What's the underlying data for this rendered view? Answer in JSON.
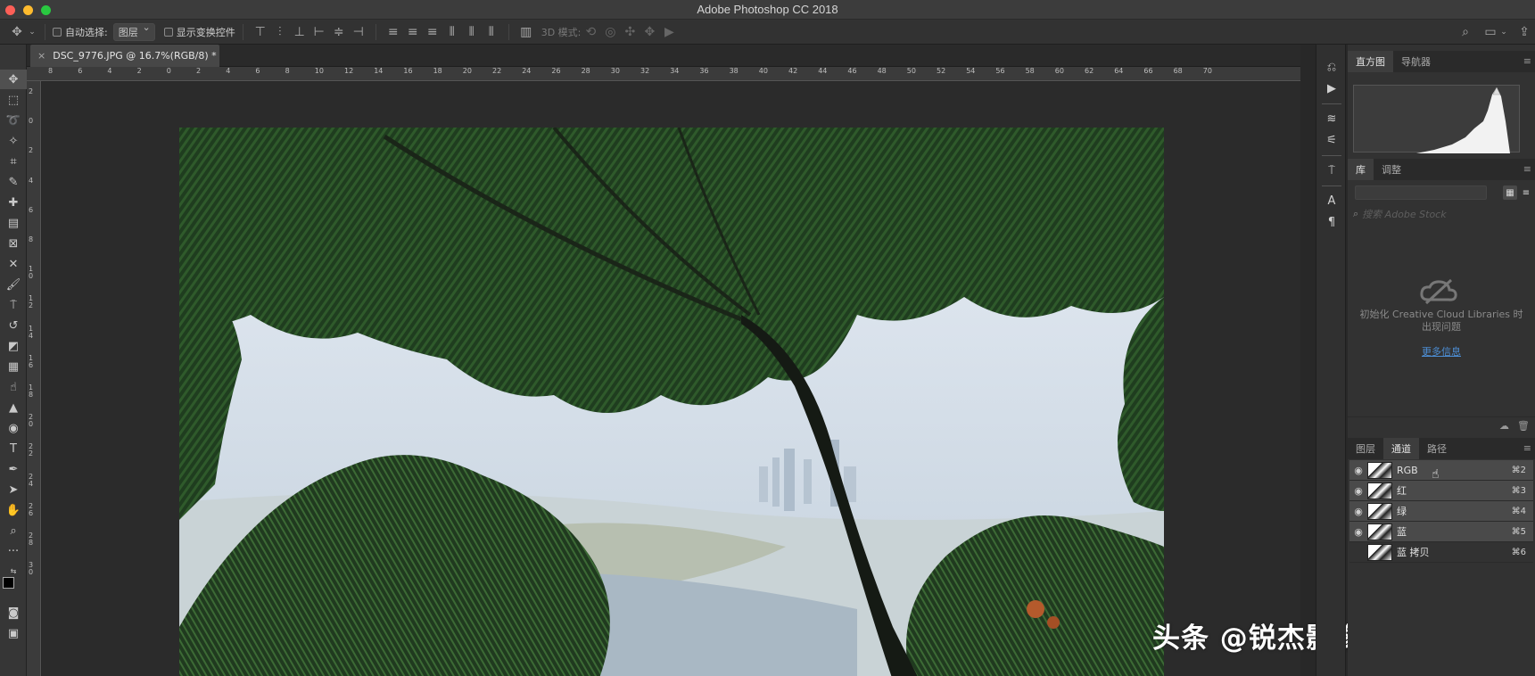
{
  "app": {
    "title": "Adobe Photoshop CC 2018"
  },
  "options_bar": {
    "auto_select_label": "自动选择:",
    "auto_select_value": "图层",
    "show_transform_label": "显示变换控件",
    "mode_3d_label": "3D 模式:"
  },
  "document": {
    "tab_title": "DSC_9776.JPG @ 16.7%(RGB/8) *",
    "tab_close": "×"
  },
  "ruler": {
    "h_labels": [
      "8",
      "6",
      "4",
      "2",
      "0",
      "2",
      "4",
      "6",
      "8",
      "10",
      "12",
      "14",
      "16",
      "18",
      "20",
      "22",
      "24",
      "26",
      "28",
      "30",
      "32",
      "34",
      "36",
      "38",
      "40",
      "42",
      "44",
      "46",
      "48",
      "50",
      "52",
      "54",
      "56",
      "58",
      "60",
      "62",
      "64",
      "66",
      "68",
      "70"
    ],
    "v_labels": [
      "2",
      "0",
      "2",
      "4",
      "6",
      "8",
      "1\n0",
      "1\n2",
      "1\n4",
      "1\n6",
      "1\n8",
      "2\n0",
      "2\n2",
      "2\n4",
      "2\n6",
      "2\n8",
      "3\n0"
    ]
  },
  "watermark": "头条 @锐杰影像课堂",
  "panels": {
    "top_tabs": [
      "直方图",
      "导航器"
    ],
    "library_tabs": [
      "库",
      "调整"
    ],
    "search_placeholder": "搜索 Adobe Stock",
    "library_message": "初始化 Creative Cloud Libraries 时出现问题",
    "more_info_link": "更多信息",
    "layer_tabs": [
      "图层",
      "通道",
      "路径"
    ]
  },
  "channels": [
    {
      "name": "RGB",
      "shortcut": "⌘2",
      "visible": true
    },
    {
      "name": "红",
      "shortcut": "⌘3",
      "visible": true
    },
    {
      "name": "绿",
      "shortcut": "⌘4",
      "visible": true
    },
    {
      "name": "蓝",
      "shortcut": "⌘5",
      "visible": true
    },
    {
      "name": "蓝 拷贝",
      "shortcut": "⌘6",
      "visible": false
    }
  ],
  "colors": {
    "accent_link": "#4d8fd6",
    "panel_bg": "#323232",
    "canvas_bg": "#2b2b2b"
  }
}
